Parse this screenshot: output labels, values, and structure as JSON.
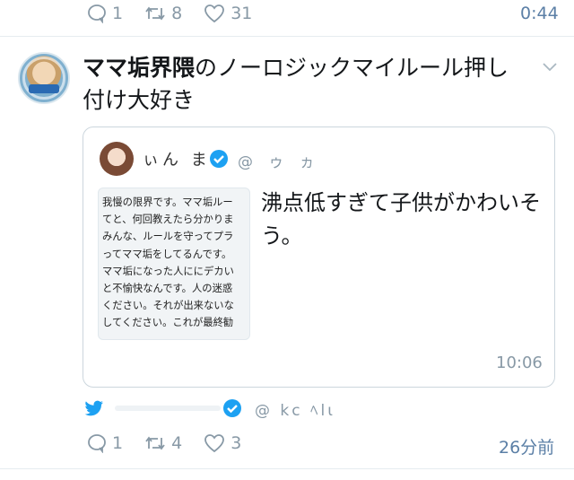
{
  "top_tweet": {
    "reply_count": "1",
    "retweet_count": "8",
    "like_count": "31",
    "timestamp": "0:44"
  },
  "tweet": {
    "author_name": "ママ垢界隈",
    "text": "のノーロジックマイルール押し付け大好き",
    "quoted": {
      "author_name": "ぃん ま",
      "handle": "@ ゥ ヵ",
      "image_text_lines": [
        "我慢の限界です。ママ垢ルー",
        "てと、何回教えたら分かりま",
        "みんな、ルールを守ってプラ",
        "ってママ垢をしてるんです。",
        "ママ垢になった人ににデカい",
        "と不愉快なんです。人の迷惑",
        "ください。それが出来ないな",
        "してください。これが最終勧"
      ],
      "text": "沸点低すぎて子供がかわいそう。",
      "timestamp": "10:06"
    },
    "source_handle": "@ kc ﾍlι",
    "reply_count": "1",
    "retweet_count": "4",
    "like_count": "3",
    "relative_time": "26分前"
  },
  "colors": {
    "twitter_blue": "#1da1f2",
    "action_gray": "#8899a6",
    "time_blue": "#5b7fa6",
    "border": "#ccd6dd"
  }
}
